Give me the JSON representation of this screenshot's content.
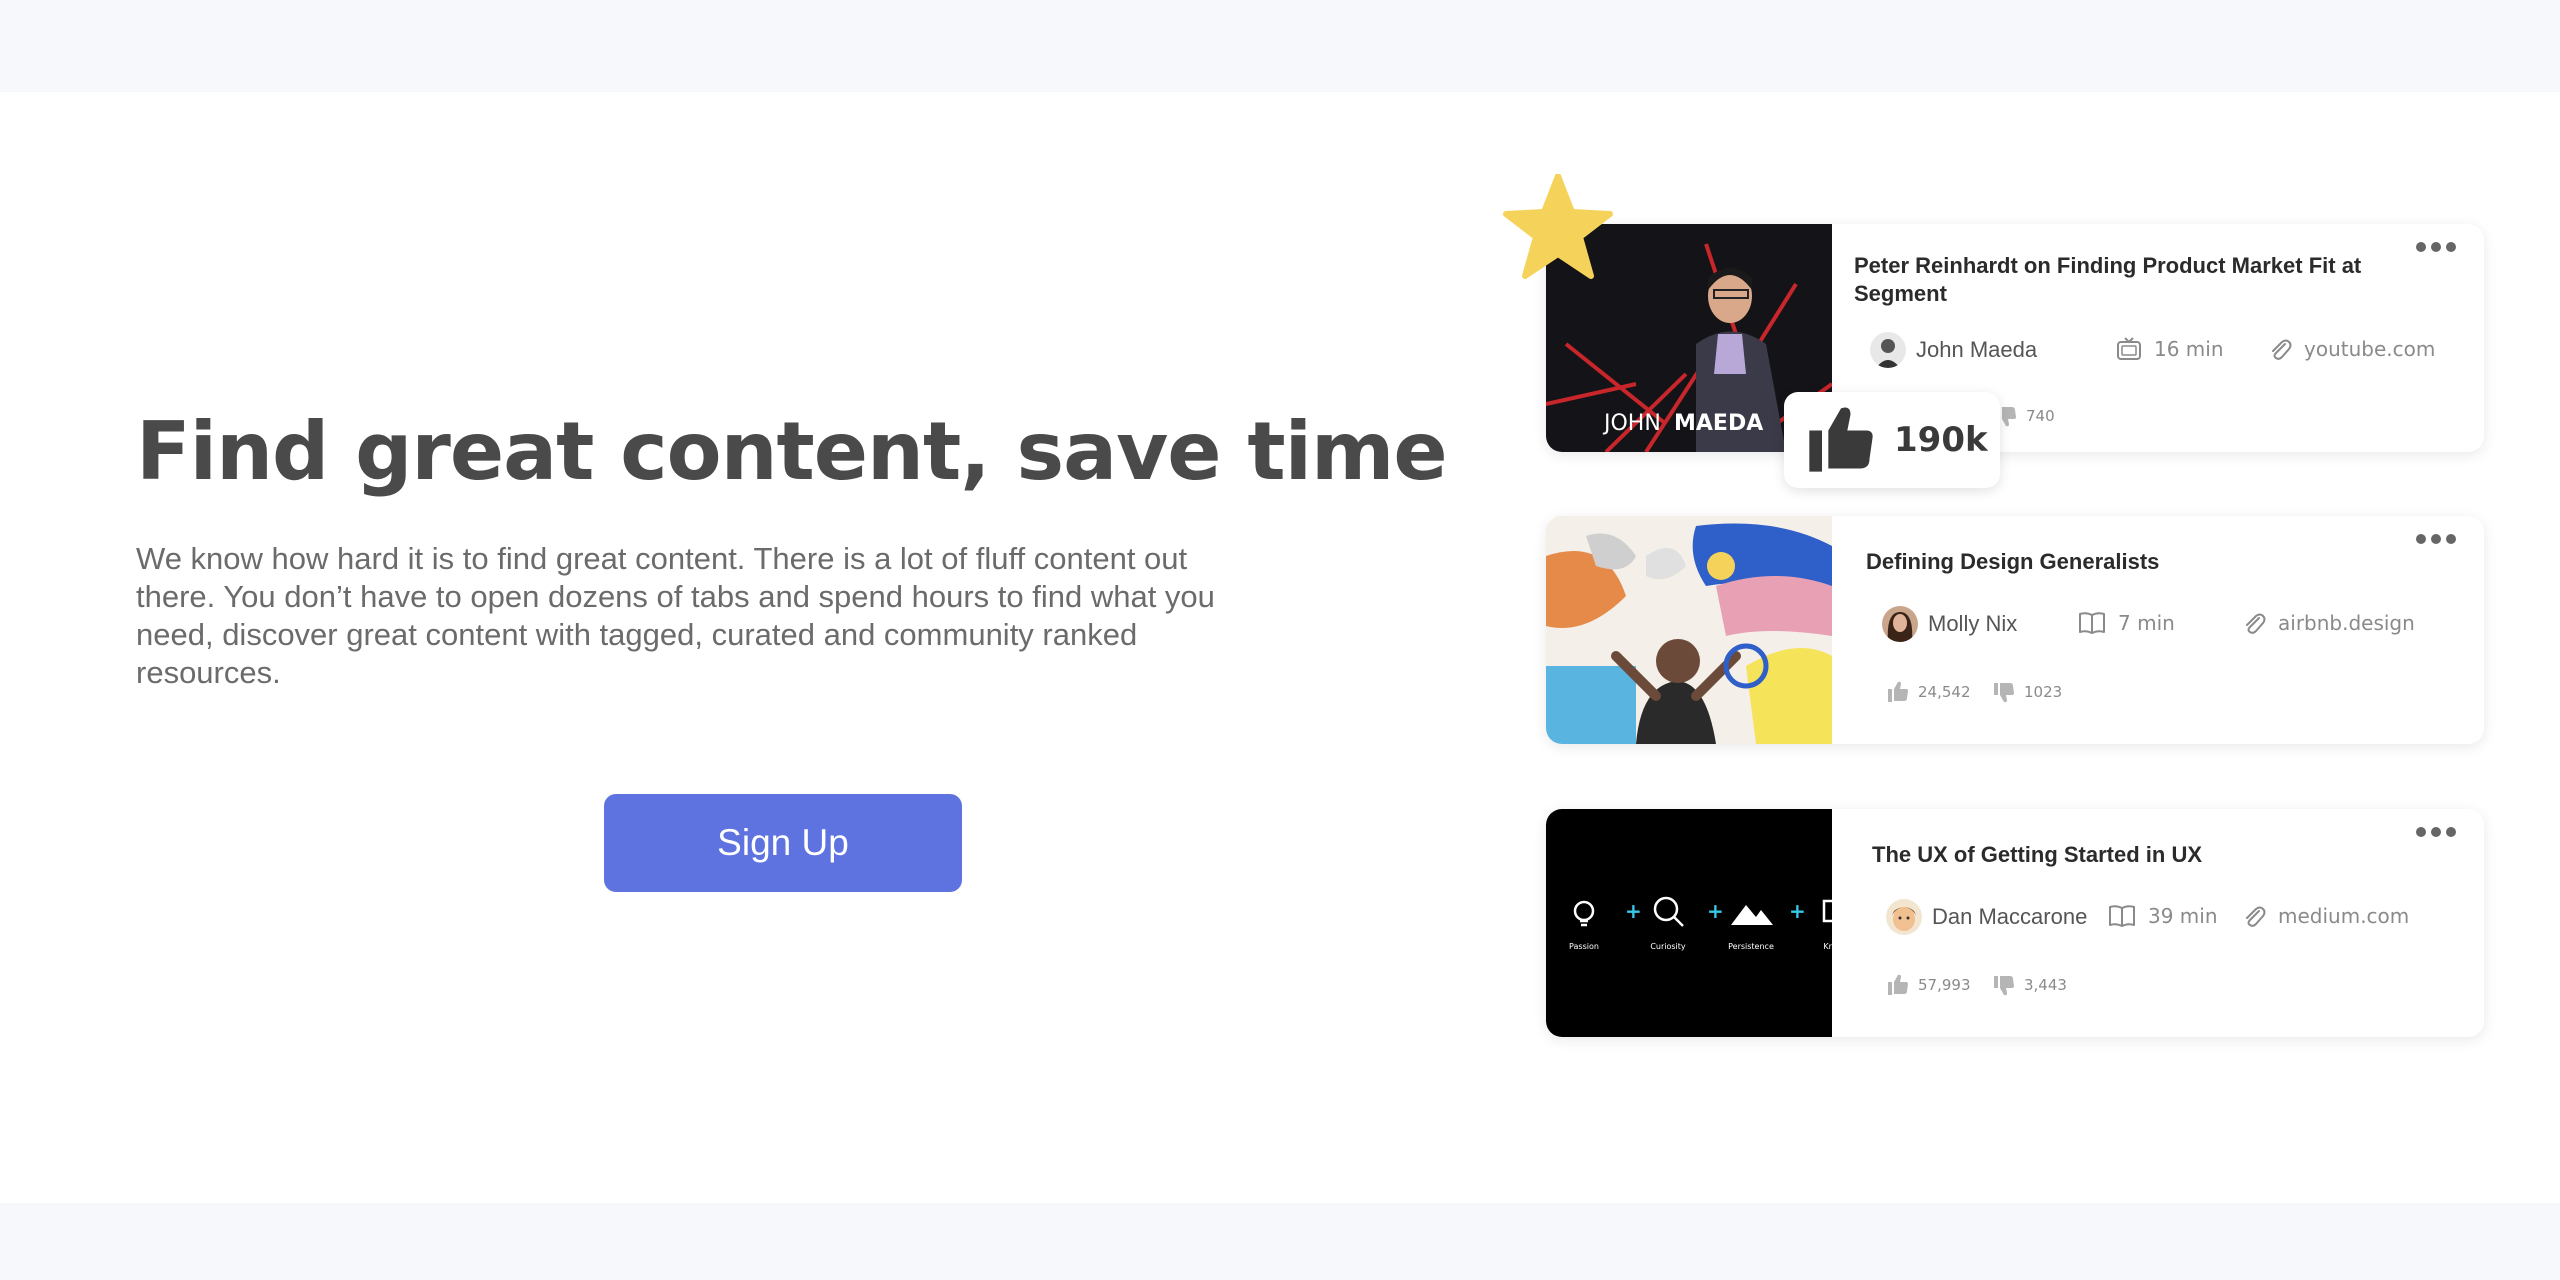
{
  "hero": {
    "headline": "Find great content, save time",
    "description": "We know how hard it is to find great content. There is a lot of fluff content out there. You don’t have to open dozens of tabs and spend hours to find what you need, discover great content with tagged, curated and community ranked resources.",
    "signup_label": "Sign Up",
    "accent_color": "#5e72e0"
  },
  "cards": [
    {
      "title": "Peter Reinhardt on Finding Product Market Fit at Segment",
      "thumb_text_light": "JOHN",
      "thumb_text_bold": "MAEDA",
      "author": "John Maeda",
      "media_icon": "tv-icon",
      "duration": "16 min",
      "source": "youtube.com",
      "dislikes": "740",
      "highlight_likes": "190k",
      "starred": true
    },
    {
      "title": "Defining Design Generalists",
      "author": "Molly Nix",
      "media_icon": "book-icon",
      "duration": "7 min",
      "source": "airbnb.design",
      "likes": "24,542",
      "dislikes": "1023"
    },
    {
      "title": "The UX of Getting Started in UX",
      "author": "Dan Maccarone",
      "media_icon": "book-icon",
      "duration": "39 min",
      "source": "medium.com",
      "likes": "57,993",
      "dislikes": "3,443",
      "thumb_labels": [
        "Passion",
        "Curiosity",
        "Persistence",
        "Kno"
      ]
    }
  ],
  "colors": {
    "star": "#f5d35a",
    "icon_gray": "#b5b5b5",
    "badge_text": "#3a3a3a"
  }
}
